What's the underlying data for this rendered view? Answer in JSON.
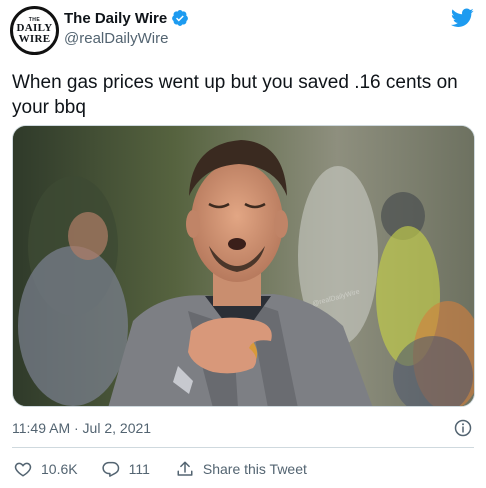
{
  "author": {
    "display_name": "The Daily Wire",
    "handle": "@realDailyWire",
    "verified": true,
    "avatar_text_top": "THE",
    "avatar_text_line1": "DAILY",
    "avatar_text_line2": "WIRE"
  },
  "tweet": {
    "text": "When gas prices went up but you saved .16 cents on your bbq",
    "timestamp": "11:49 AM · Jul 2, 2021"
  },
  "actions": {
    "likes": "10.6K",
    "replies": "111",
    "share_label": "Share this Tweet"
  },
  "colors": {
    "twitter_blue": "#1d9bf0",
    "like_red": "#f91880",
    "secondary_text": "#536471"
  },
  "icons": {
    "platform": "twitter-bird-icon",
    "verified": "verified-badge-icon",
    "info": "info-icon",
    "like": "heart-icon",
    "reply": "reply-bubble-icon",
    "share": "share-upload-icon"
  }
}
